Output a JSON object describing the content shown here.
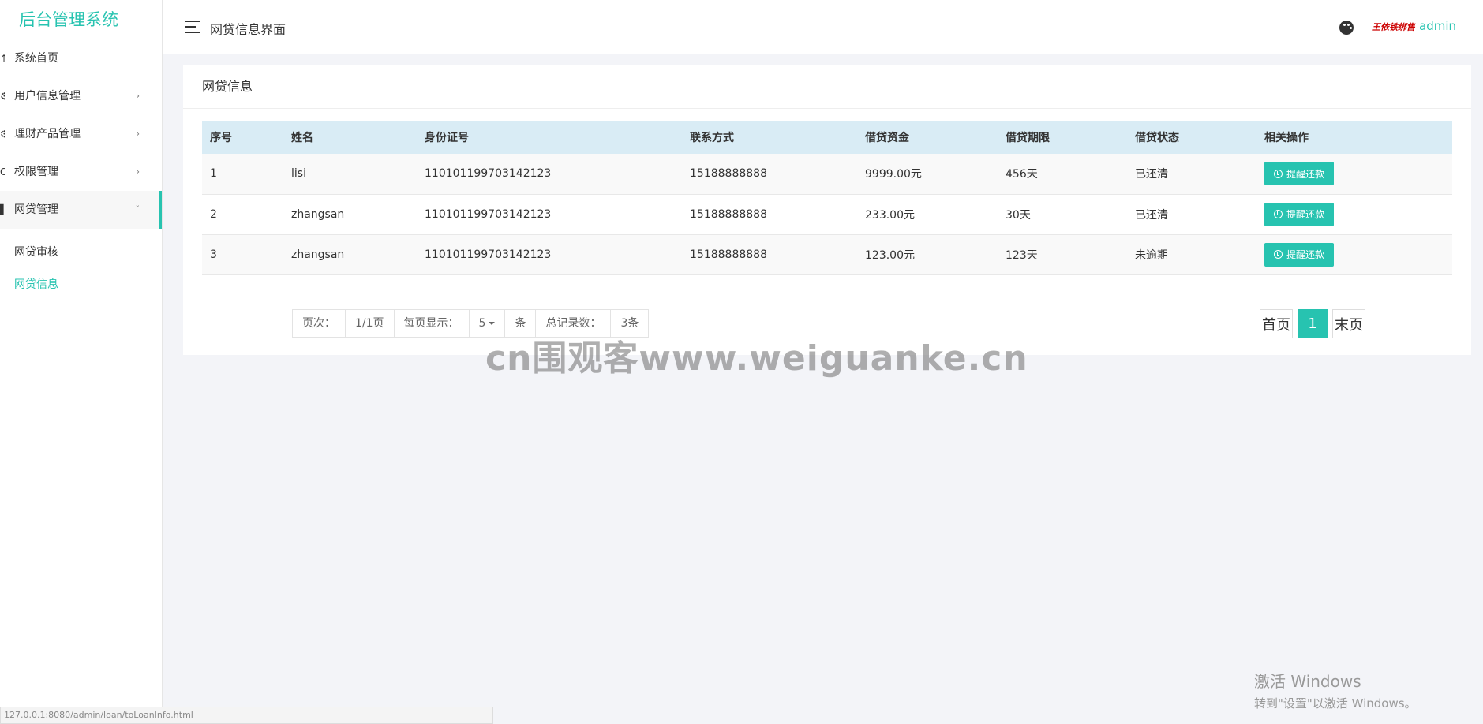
{
  "sidebar": {
    "brand": "后台管理系统",
    "items": [
      {
        "label": "系统首页",
        "has_arrow": false
      },
      {
        "label": "用户信息管理",
        "has_arrow": true
      },
      {
        "label": "理财产品管理",
        "has_arrow": true
      },
      {
        "label": "权限管理",
        "has_arrow": true
      },
      {
        "label": "网贷管理",
        "has_arrow": true,
        "open": true
      }
    ],
    "submenu": [
      {
        "label": "网贷审核",
        "active": false
      },
      {
        "label": "网贷信息",
        "active": true
      }
    ],
    "arrow_closed": "›",
    "arrow_open": "ˇ"
  },
  "header": {
    "title": "网贷信息界面",
    "signature": "王依铁绑售",
    "user": "admin"
  },
  "card": {
    "title": "网贷信息",
    "columns": [
      "序号",
      "姓名",
      "身份证号",
      "联系方式",
      "借贷资金",
      "借贷期限",
      "借贷状态",
      "相关操作"
    ],
    "rows": [
      {
        "id": "1",
        "name": "lisi",
        "id_card": "110101199703142123",
        "phone": "15188888888",
        "amount": "9999.00元",
        "term": "456天",
        "status": "已还清",
        "action": "提醒还款"
      },
      {
        "id": "2",
        "name": "zhangsan",
        "id_card": "110101199703142123",
        "phone": "15188888888",
        "amount": "233.00元",
        "term": "30天",
        "status": "已还清",
        "action": "提醒还款"
      },
      {
        "id": "3",
        "name": "zhangsan",
        "id_card": "110101199703142123",
        "phone": "15188888888",
        "amount": "123.00元",
        "term": "123天",
        "status": "未逾期",
        "action": "提醒还款"
      }
    ]
  },
  "pagination": {
    "page_label": "页次：",
    "page_value": "1/1页",
    "per_page_label": "每页显示：",
    "per_page_value": "5",
    "unit": "条",
    "total_label": "总记录数：",
    "total_value": "3条",
    "first": "首页",
    "current": "1",
    "last": "末页"
  },
  "watermark": "cn围观客www.weiguanke.cn",
  "windows_activation": {
    "line1": "激活 Windows",
    "line2": "转到\"设置\"以激活 Windows。"
  },
  "status_bar": "127.0.0.1:8080/admin/loan/toLoanInfo.html"
}
